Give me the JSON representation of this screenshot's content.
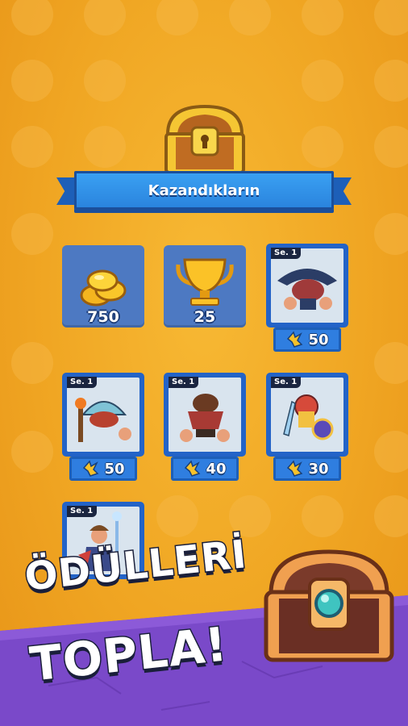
{
  "header": {
    "title": "Kazandıkların"
  },
  "rewards": [
    {
      "kind": "gold",
      "icon": "gold-coins-icon",
      "amount": "750"
    },
    {
      "kind": "trophy",
      "icon": "trophy-icon",
      "amount": "25"
    }
  ],
  "cards": [
    {
      "season": "Se. 1",
      "icon": "brawler-hat-icon",
      "shards": "50"
    },
    {
      "season": "Se. 1",
      "icon": "brawler-mage-icon",
      "shards": "50"
    },
    {
      "season": "Se. 1",
      "icon": "brawler-rogue-icon",
      "shards": "40"
    },
    {
      "season": "Se. 1",
      "icon": "brawler-knight-icon",
      "shards": "30"
    },
    {
      "season": "Se. 1",
      "icon": "brawler-wizard-icon",
      "shards": ""
    }
  ],
  "promo": {
    "line1": "ÖDÜLLERİ",
    "line2": "TOPLA!"
  },
  "colors": {
    "background": "#f0a623",
    "banner": "#2a84de",
    "tile": "#4d79c2",
    "card_border": "#2363c7",
    "floor": "#7a49c9"
  }
}
